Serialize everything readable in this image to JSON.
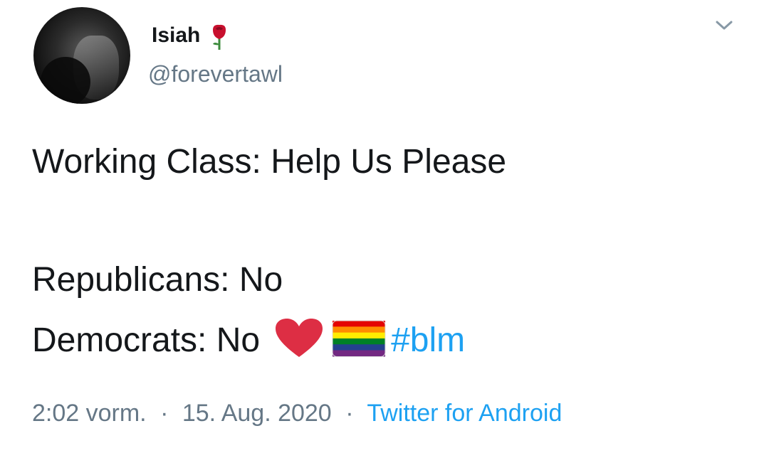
{
  "user": {
    "display_name": "Isiah",
    "handle": "@forevertawl",
    "name_emoji": "rose-icon",
    "avatar": "avatar-photo"
  },
  "tweet": {
    "line1": "Working Class: Help Us Please",
    "line2": "Republicans: No",
    "line3": "Democrats: No",
    "emojis": [
      "heart-icon",
      "rainbow-flag-icon"
    ],
    "hashtag": "#blm"
  },
  "meta": {
    "time": "2:02 vorm.",
    "separator": "·",
    "date": "15. Aug. 2020",
    "source": "Twitter for Android"
  },
  "menu": {
    "icon": "chevron-down-icon"
  },
  "colors": {
    "text": "#14171a",
    "secondary": "#657786",
    "link": "#1da1f2",
    "heart": "#e0245e"
  }
}
